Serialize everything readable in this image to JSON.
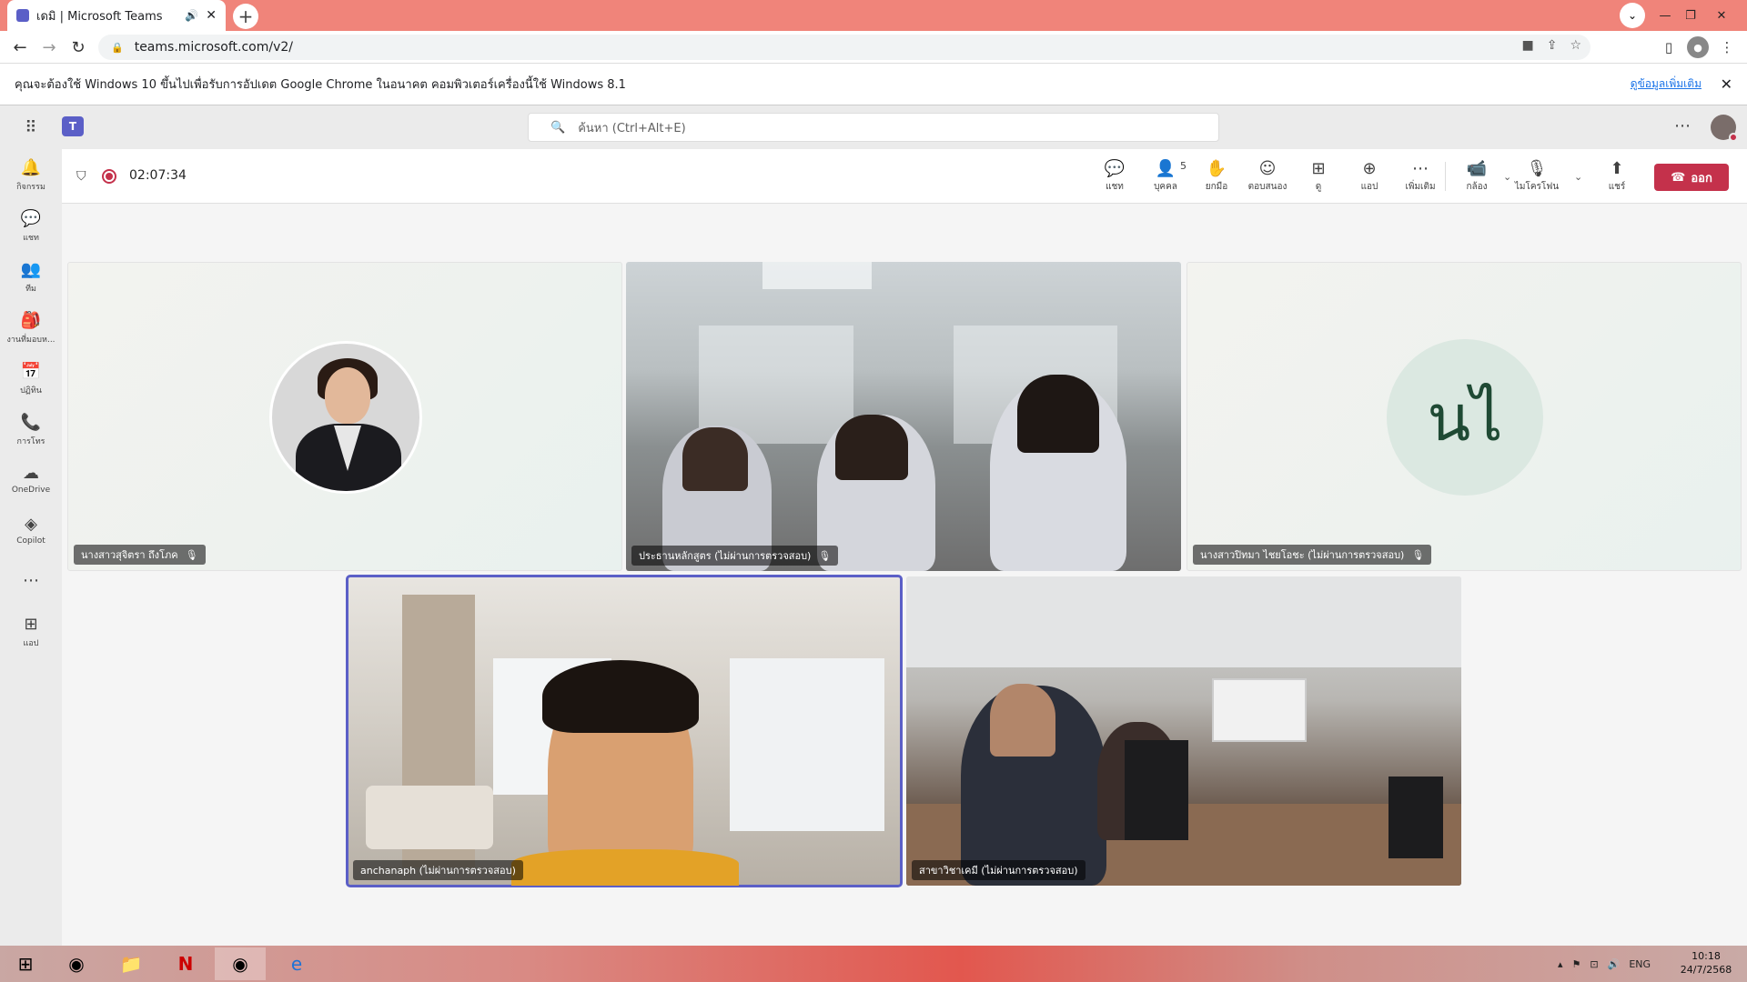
{
  "browser": {
    "tab_title": "เดมิ | Microsoft Teams",
    "url": "teams.microsoft.com/v2/",
    "infobar_text": "คุณจะต้องใช้ Windows 10 ขึ้นไปเพื่อรับการอัปเดต Google Chrome ในอนาคต คอมพิวเตอร์เครื่องนี้ใช้ Windows 8.1",
    "infobar_link": "ดูข้อมูลเพิ่มเติม"
  },
  "teams": {
    "search_placeholder": "ค้นหา (Ctrl+Alt+E)",
    "rail": [
      {
        "label": "กิจกรรม",
        "icon": "bell-icon"
      },
      {
        "label": "แชท",
        "icon": "chat-icon"
      },
      {
        "label": "ทีม",
        "icon": "teams-icon"
      },
      {
        "label": "งานที่มอบห...",
        "icon": "assignments-icon"
      },
      {
        "label": "ปฏิทิน",
        "icon": "calendar-icon"
      },
      {
        "label": "การโทร",
        "icon": "phone-icon"
      },
      {
        "label": "OneDrive",
        "icon": "cloud-icon"
      },
      {
        "label": "Copilot",
        "icon": "copilot-icon"
      },
      {
        "label": "",
        "icon": "more-icon"
      },
      {
        "label": "แอป",
        "icon": "add-app-icon"
      }
    ]
  },
  "meeting": {
    "timer": "02:07:34",
    "controls": {
      "chat": "แชท",
      "people": "บุคคล",
      "people_count": "5",
      "raise": "ยกมือ",
      "react": "ตอบสนอง",
      "view": "ดู",
      "apps": "แอป",
      "more": "เพิ่มเติม",
      "camera": "กล้อง",
      "mic": "ไมโครโฟน",
      "share": "แชร์",
      "leave": "ออก"
    },
    "participants": [
      {
        "name": "นางสาวสุจิตรา ถึงโภค",
        "muted": true
      },
      {
        "name": "ประธานหลักสูตร (ไม่ผ่านการตรวจสอบ)",
        "muted": true
      },
      {
        "name": "นางสาวปิทมา ไชยโอชะ (ไม่ผ่านการตรวจสอบ)",
        "muted": true,
        "initials": "นไ"
      },
      {
        "name": "anchanaph (ไม่ผ่านการตรวจสอบ)",
        "muted": false
      },
      {
        "name": "สาขาวิชาเคมี (ไม่ผ่านการตรวจสอบ)",
        "muted": false
      }
    ]
  },
  "taskbar": {
    "language": "ENG",
    "time": "10:18",
    "date": "24/7/2568"
  },
  "colors": {
    "tab_strip": "#f0847a",
    "teams_purple": "#5b5fc7",
    "leave_red": "#c4314b"
  }
}
